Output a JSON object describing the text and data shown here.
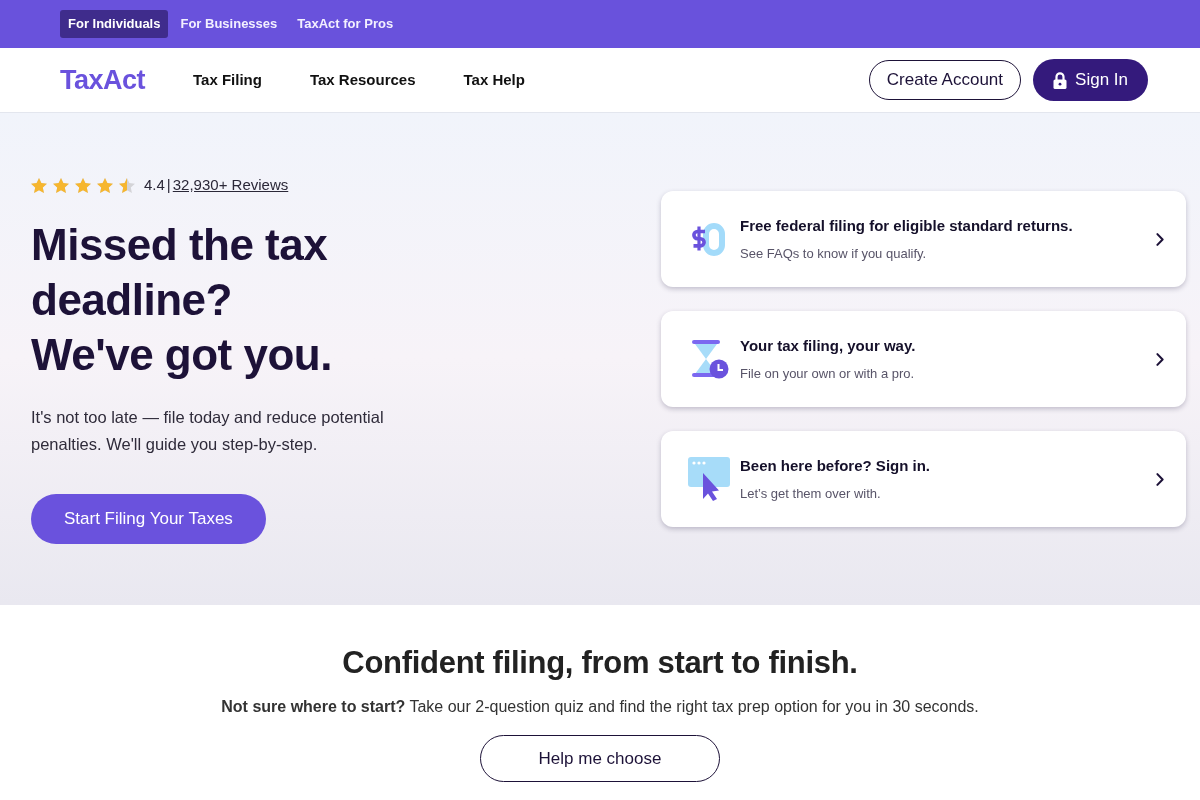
{
  "top_bar": {
    "tabs": [
      {
        "label": "For Individuals",
        "selected": true
      },
      {
        "label": "For Businesses",
        "selected": false
      },
      {
        "label": "TaxAct for Pros",
        "selected": false
      }
    ]
  },
  "nav": {
    "logo": "TaxAct",
    "links": [
      "Tax Filing",
      "Tax Resources",
      "Tax Help"
    ],
    "buttons": [
      {
        "label": "Create Account",
        "kind": "outline"
      },
      {
        "label": "Sign In",
        "kind": "solid"
      }
    ]
  },
  "hero": {
    "rating": {
      "stars": 4.5,
      "score": "4.4",
      "separator": "|",
      "reviews": "32,930+ Reviews"
    },
    "headline": [
      "Missed the tax deadline?",
      "We've got you."
    ],
    "description": "It's not too late — file today and reduce potential penalties. We'll guide you step-by-step.",
    "cta": "Start Filing Your Taxes",
    "cards": [
      {
        "kind": "zero-dollar",
        "title": "Free federal filing for eligible standard returns.",
        "subtitle": "See FAQs to know if you qualify."
      },
      {
        "kind": "hourglass",
        "title": "Your tax filing, your way.",
        "subtitle": "File on your own or with a pro."
      },
      {
        "kind": "browser-cursor",
        "title": "Been here before? Sign in.",
        "subtitle": "Let’s get them over with."
      }
    ]
  },
  "quiz": {
    "title": "Confident filing, from start to finish.",
    "text": "**Not sure where to start?** Take our 2-question quiz and find the right tax prep option for you in 30 seconds.",
    "button": "Help me choose"
  }
}
